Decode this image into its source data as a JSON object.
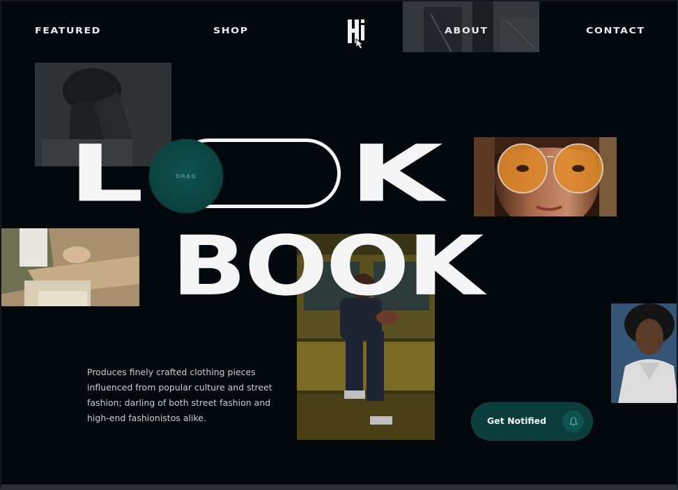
{
  "nav": {
    "featured": "FEATURED",
    "shop": "SHOP",
    "about": "ABOUT",
    "contact": "CONTACT"
  },
  "logo": {
    "text": "Hi",
    "icon": "hand-cursor-icon"
  },
  "hero": {
    "word1_start": "L",
    "word1_end": "K",
    "word2": "BOOK",
    "drag_label": "DRAG"
  },
  "description": "Produces finely crafted clothing pieces influenced from popular culture and street fashion; darling of both street fashion and high-end fashionistos alike.",
  "cta": {
    "label": "Get Notified",
    "icon": "bell-icon"
  },
  "colors": {
    "background": "#03080c",
    "accent": "#0c3d3d",
    "text": "#f4f5f4"
  }
}
